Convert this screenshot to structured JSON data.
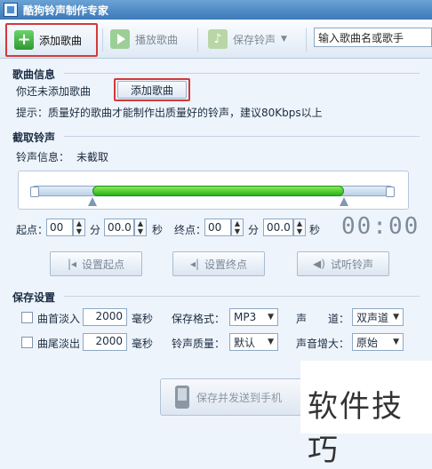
{
  "window": {
    "title": "酷狗铃声制作专家"
  },
  "toolbar": {
    "add_song": "添加歌曲",
    "play_song": "播放歌曲",
    "save_ringtone": "保存铃声",
    "search_value": "输入歌曲名或歌手"
  },
  "song_info": {
    "header": "歌曲信息",
    "status": "你还未添加歌曲",
    "add_button": "添加歌曲",
    "tip": "提示：质量好的歌曲才能制作出质量好的铃声，建议80Kbps以上"
  },
  "clip": {
    "header": "截取铃声",
    "info_label": "铃声信息：",
    "info_value": "未截取",
    "start_label": "起点：",
    "start_min": "00",
    "start_sec": "00.0",
    "end_label": "终点：",
    "end_min": "00",
    "end_sec": "00.0",
    "unit_min": "分",
    "unit_sec": "秒",
    "time_display": "00:00",
    "selection_start": 0.17,
    "selection_end": 0.86,
    "set_start": "设置起点",
    "set_end": "设置终点",
    "preview": "试听铃声"
  },
  "save": {
    "header": "保存设置",
    "fade_in_label": "曲首淡入",
    "fade_in_value": "2000",
    "fade_out_label": "曲尾淡出",
    "fade_out_value": "2000",
    "ms_unit": "毫秒",
    "format_label": "保存格式：",
    "format_value": "MP3",
    "channel_label": "声　　道：",
    "channel_value": "双声道",
    "quality_label": "铃声质量：",
    "quality_value": "默认",
    "volume_label": "声音增大：",
    "volume_value": "原始",
    "send_button": "保存并发送到手机"
  },
  "watermark": "软件技巧",
  "colors": {
    "accent": "#3d79b8",
    "highlight": "#d23a3a",
    "fill": "#25b31c"
  }
}
